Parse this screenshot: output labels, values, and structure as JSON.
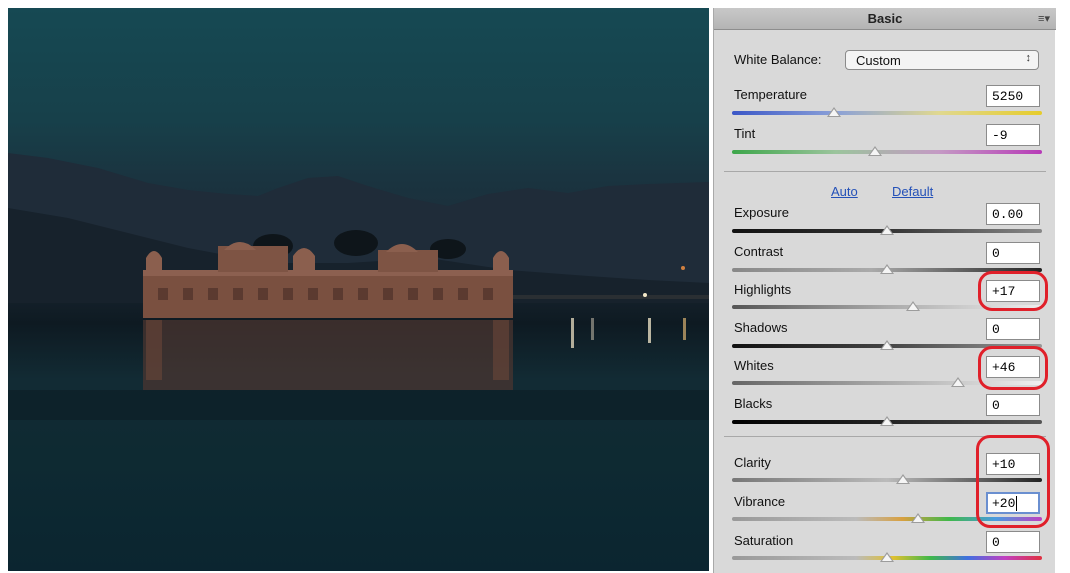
{
  "panel": {
    "title": "Basic",
    "menu_icon": "panel-menu-icon",
    "white_balance": {
      "label": "White Balance:",
      "value": "Custom",
      "arrow": "↕"
    },
    "auto_label": "Auto",
    "default_label": "Default"
  },
  "sliders": [
    {
      "key": "temperature",
      "label": "Temperature",
      "value": "5250",
      "position": 0.33
    },
    {
      "key": "tint",
      "label": "Tint",
      "value": "-9",
      "position": 0.46
    },
    {
      "key": "exposure",
      "label": "Exposure",
      "value": "0.00",
      "position": 0.5
    },
    {
      "key": "contrast",
      "label": "Contrast",
      "value": "0",
      "position": 0.5
    },
    {
      "key": "highlights",
      "label": "Highlights",
      "value": "+17",
      "position": 0.585
    },
    {
      "key": "shadows",
      "label": "Shadows",
      "value": "0",
      "position": 0.5
    },
    {
      "key": "whites",
      "label": "Whites",
      "value": "+46",
      "position": 0.73
    },
    {
      "key": "blacks",
      "label": "Blacks",
      "value": "0",
      "position": 0.5
    },
    {
      "key": "clarity",
      "label": "Clarity",
      "value": "+10",
      "position": 0.55
    },
    {
      "key": "vibrance",
      "label": "Vibrance",
      "value": "+20",
      "position": 0.6
    },
    {
      "key": "saturation",
      "label": "Saturation",
      "value": "0",
      "position": 0.5
    }
  ],
  "colors": {
    "highlight_circle": "#e0202a",
    "link": "#2451b8"
  }
}
